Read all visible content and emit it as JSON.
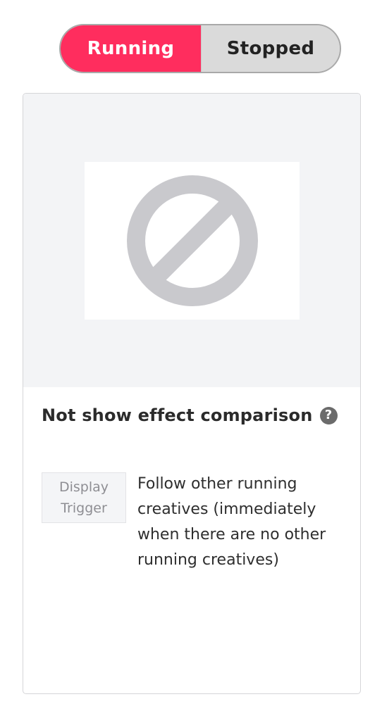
{
  "status_toggle": {
    "running_label": "Running",
    "stopped_label": "Stopped",
    "selected": "Running",
    "colors": {
      "active_bg": "#ff2d5e",
      "inactive_bg": "#dadada"
    }
  },
  "card": {
    "preview": {
      "icon": "no-image-prohibited-icon"
    },
    "title": "Not show effect comparison",
    "help_icon": "question-circle-icon",
    "help_glyph": "?",
    "trigger": {
      "badge_line1": "Display",
      "badge_line2": "Trigger",
      "description": "Follow other running creatives (immediately when there are no other running creatives)"
    }
  }
}
